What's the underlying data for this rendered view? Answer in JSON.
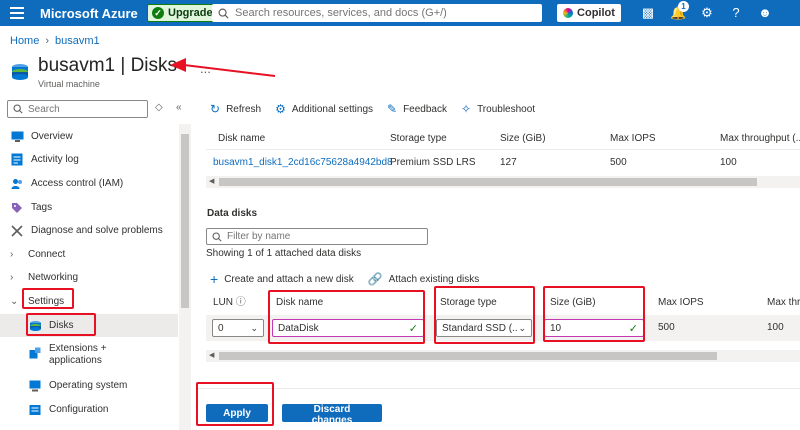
{
  "header": {
    "brand": "Microsoft Azure",
    "upgrade_label": "Upgrade",
    "search_placeholder": "Search resources, services, and docs (G+/)",
    "copilot_label": "Copilot",
    "notification_count": "1",
    "bg_color": "#0f6cbd"
  },
  "breadcrumb": {
    "home": "Home",
    "vm": "busavm1"
  },
  "page": {
    "title": "busavm1 | Disks",
    "subtitle": "Virtual machine",
    "more": "..."
  },
  "sidebar": {
    "search_placeholder": "Search",
    "items": [
      {
        "label": "Overview",
        "icon": "monitor-icon"
      },
      {
        "label": "Activity log",
        "icon": "log-icon"
      },
      {
        "label": "Access control (IAM)",
        "icon": "people-icon"
      },
      {
        "label": "Tags",
        "icon": "tag-icon"
      },
      {
        "label": "Diagnose and solve problems",
        "icon": "wrench-icon"
      },
      {
        "label": "Connect",
        "icon": "chevron-right-icon"
      },
      {
        "label": "Networking",
        "icon": "chevron-right-icon"
      },
      {
        "label": "Settings",
        "icon": "chevron-down-icon"
      },
      {
        "label": "Disks",
        "icon": "disk-icon"
      },
      {
        "label": "Extensions +",
        "label2": "applications",
        "icon": "extension-icon"
      },
      {
        "label": "Operating system",
        "icon": "os-icon"
      },
      {
        "label": "Configuration",
        "icon": "config-icon"
      }
    ]
  },
  "toolbar": {
    "refresh": "Refresh",
    "additional_settings": "Additional settings",
    "feedback": "Feedback",
    "troubleshoot": "Troubleshoot"
  },
  "os_disk": {
    "columns": [
      "Disk name",
      "Storage type",
      "Size (GiB)",
      "Max IOPS",
      "Max throughput (..."
    ],
    "row": [
      "busavm1_disk1_2cd16c75628a4942bd8",
      "Premium SSD LRS",
      "127",
      "500",
      "100"
    ]
  },
  "data_disks": {
    "title": "Data disks",
    "filter_placeholder": "Filter by name",
    "showing": "Showing 1 of 1 attached data disks",
    "create_attach": "Create and attach a new disk",
    "attach_existing": "Attach existing disks",
    "columns": [
      "LUN",
      "Disk name",
      "Storage type",
      "Size (GiB)",
      "Max IOPS",
      "Max thro"
    ],
    "row": {
      "lun": "0",
      "disk_name": "DataDisk",
      "storage_type": "Standard SSD (...",
      "size": "10",
      "max_iops": "500",
      "max_throughput": "100"
    }
  },
  "footer": {
    "apply": "Apply",
    "discard": "Discard changes"
  }
}
